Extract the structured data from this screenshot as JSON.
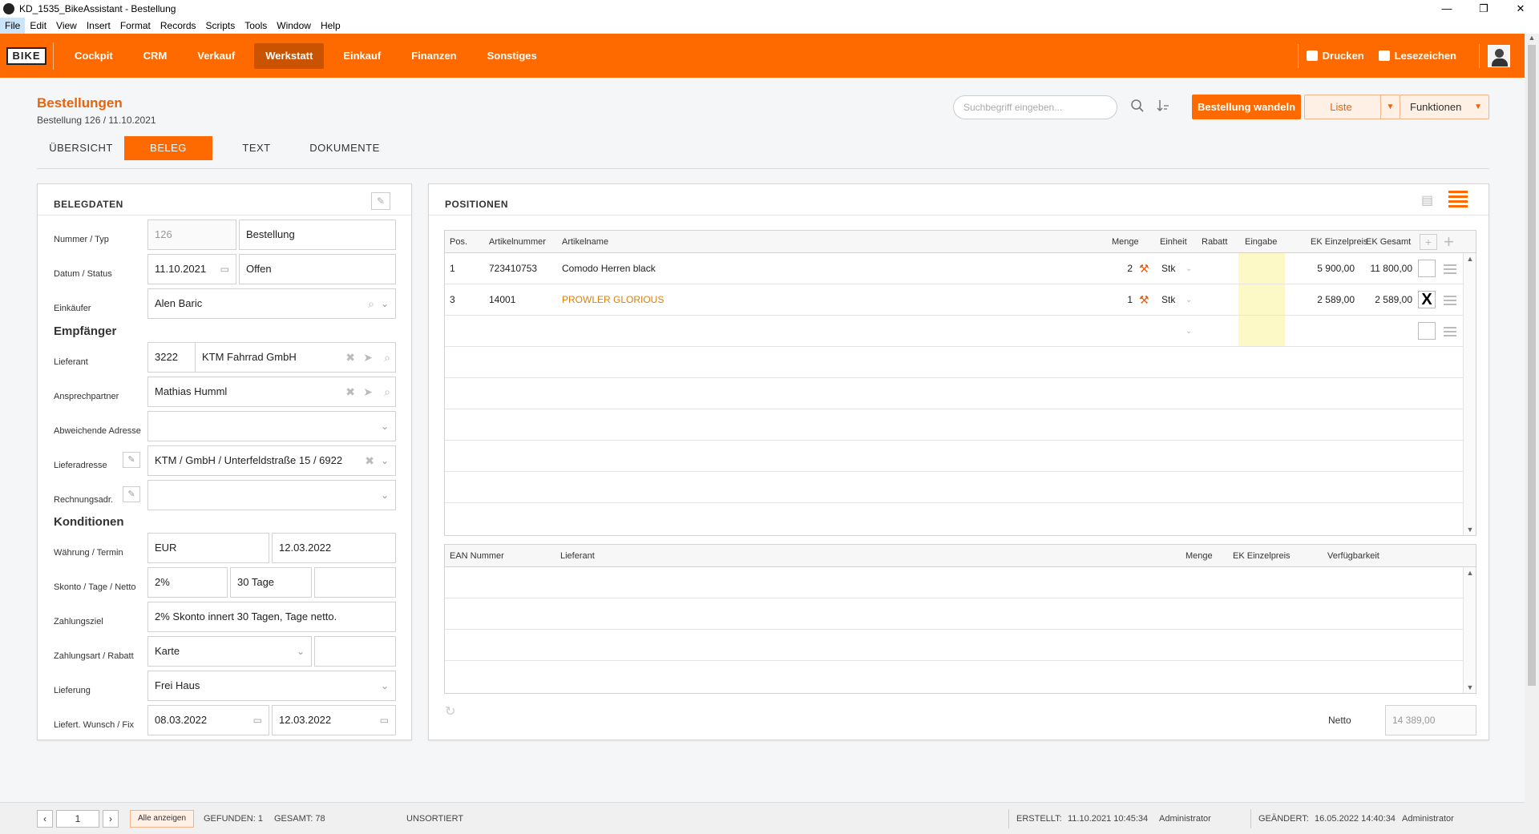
{
  "window": {
    "title": "KD_1535_BikeAssistant - Bestellung",
    "controls": [
      "—",
      "❐",
      "✕"
    ]
  },
  "menu": [
    "File",
    "Edit",
    "View",
    "Insert",
    "Format",
    "Records",
    "Scripts",
    "Tools",
    "Window",
    "Help"
  ],
  "nav": {
    "logo": "BIKE",
    "items": [
      "Cockpit",
      "CRM",
      "Verkauf",
      "Werkstatt",
      "Einkauf",
      "Finanzen",
      "Sonstiges"
    ],
    "active": "Werkstatt",
    "print_label": "Drucken",
    "bookmark_label": "Lesezeichen"
  },
  "header": {
    "title": "Bestellungen",
    "subtitle": "Bestellung 126 / 11.10.2021",
    "search_placeholder": "Suchbegriff eingeben...",
    "btn_convert": "Bestellung wandeln",
    "btn_list": "Liste",
    "btn_functions": "Funktionen",
    "tabs": [
      "ÜBERSICHT",
      "BELEG",
      "TEXT",
      "DOKUMENTE"
    ],
    "active_tab": "BELEG"
  },
  "belegdaten": {
    "title": "BELEGDATEN",
    "fields": {
      "nummer_typ_label": "Nummer / Typ",
      "nummer": "126",
      "typ": "Bestellung",
      "datum_status_label": "Datum / Status",
      "datum": "11.10.2021",
      "status": "Offen",
      "einkaeufer_label": "Einkäufer",
      "einkaeufer": "Alen Baric",
      "empfaenger_heading": "Empfänger",
      "lieferant_label": "Lieferant",
      "lieferant_nr": "3222",
      "lieferant_name": "KTM Fahrrad GmbH",
      "ansprechpartner_label": "Ansprechpartner",
      "ansprechpartner": "Mathias Humml",
      "abw_adresse_label": "Abweichende Adresse",
      "abw_adresse": "",
      "lieferadresse_label": "Lieferadresse",
      "lieferadresse": "KTM / GmbH / Unterfeldstraße 15 / 6922",
      "rechnungsadr_label": "Rechnungsadr.",
      "rechnungsadr": "",
      "konditionen_heading": "Konditionen",
      "waehrung_termin_label": "Währung / Termin",
      "waehrung": "EUR",
      "termin": "12.03.2022",
      "skonto_label": "Skonto / Tage / Netto",
      "skonto": "2%",
      "tage": "30 Tage",
      "netto_tage": "",
      "zahlungsziel_label": "Zahlungsziel",
      "zahlungsziel": "2% Skonto innert 30 Tagen,  Tage netto.",
      "zahlungsart_label": "Zahlungsart / Rabatt",
      "zahlungsart": "Karte",
      "rabatt": "",
      "lieferung_label": "Lieferung",
      "lieferung": "Frei Haus",
      "liefert_wunsch_label": "Liefert. Wunsch / Fix",
      "wunsch": "08.03.2022",
      "fix": "12.03.2022"
    }
  },
  "positionen": {
    "title": "POSITIONEN",
    "columns": [
      "Pos.",
      "Artikelnummer",
      "Artikelname",
      "Menge",
      "Einheit",
      "Rabatt",
      "Eingabe",
      "EK Einzelpreis",
      "EK Gesamt"
    ],
    "rows": [
      {
        "pos": "1",
        "artnr": "723410753",
        "name": "Comodo Herren black",
        "menge": "2",
        "einheit": "Stk",
        "rabatt": "",
        "ek": "5 900,00",
        "gesamt": "11 800,00",
        "checked": "",
        "highlight": false
      },
      {
        "pos": "3",
        "artnr": "14001",
        "name": "PROWLER GLORIOUS",
        "menge": "1",
        "einheit": "Stk",
        "rabatt": "",
        "ek": "2 589,00",
        "gesamt": "2 589,00",
        "checked": "X",
        "highlight": true
      }
    ],
    "ean_columns": [
      "EAN Nummer",
      "Lieferant",
      "Menge",
      "EK Einzelpreis",
      "Verfügbarkeit"
    ],
    "netto_label": "Netto",
    "netto_value": "14 389,00",
    "accent_color": "#ff6a00",
    "link_color": "#d9820a"
  },
  "statusbar": {
    "page": "1",
    "show_all": "Alle anzeigen",
    "found": "GEFUNDEN: 1",
    "total": "GESAMT: 78",
    "sort": "UNSORTIERT",
    "created_label": "ERSTELLT:",
    "created_date": "11.10.2021 10:45:34",
    "created_by": "Administrator",
    "changed_label": "GEÄNDERT:",
    "changed_date": "16.05.2022 14:40:34",
    "changed_by": "Administrator"
  }
}
